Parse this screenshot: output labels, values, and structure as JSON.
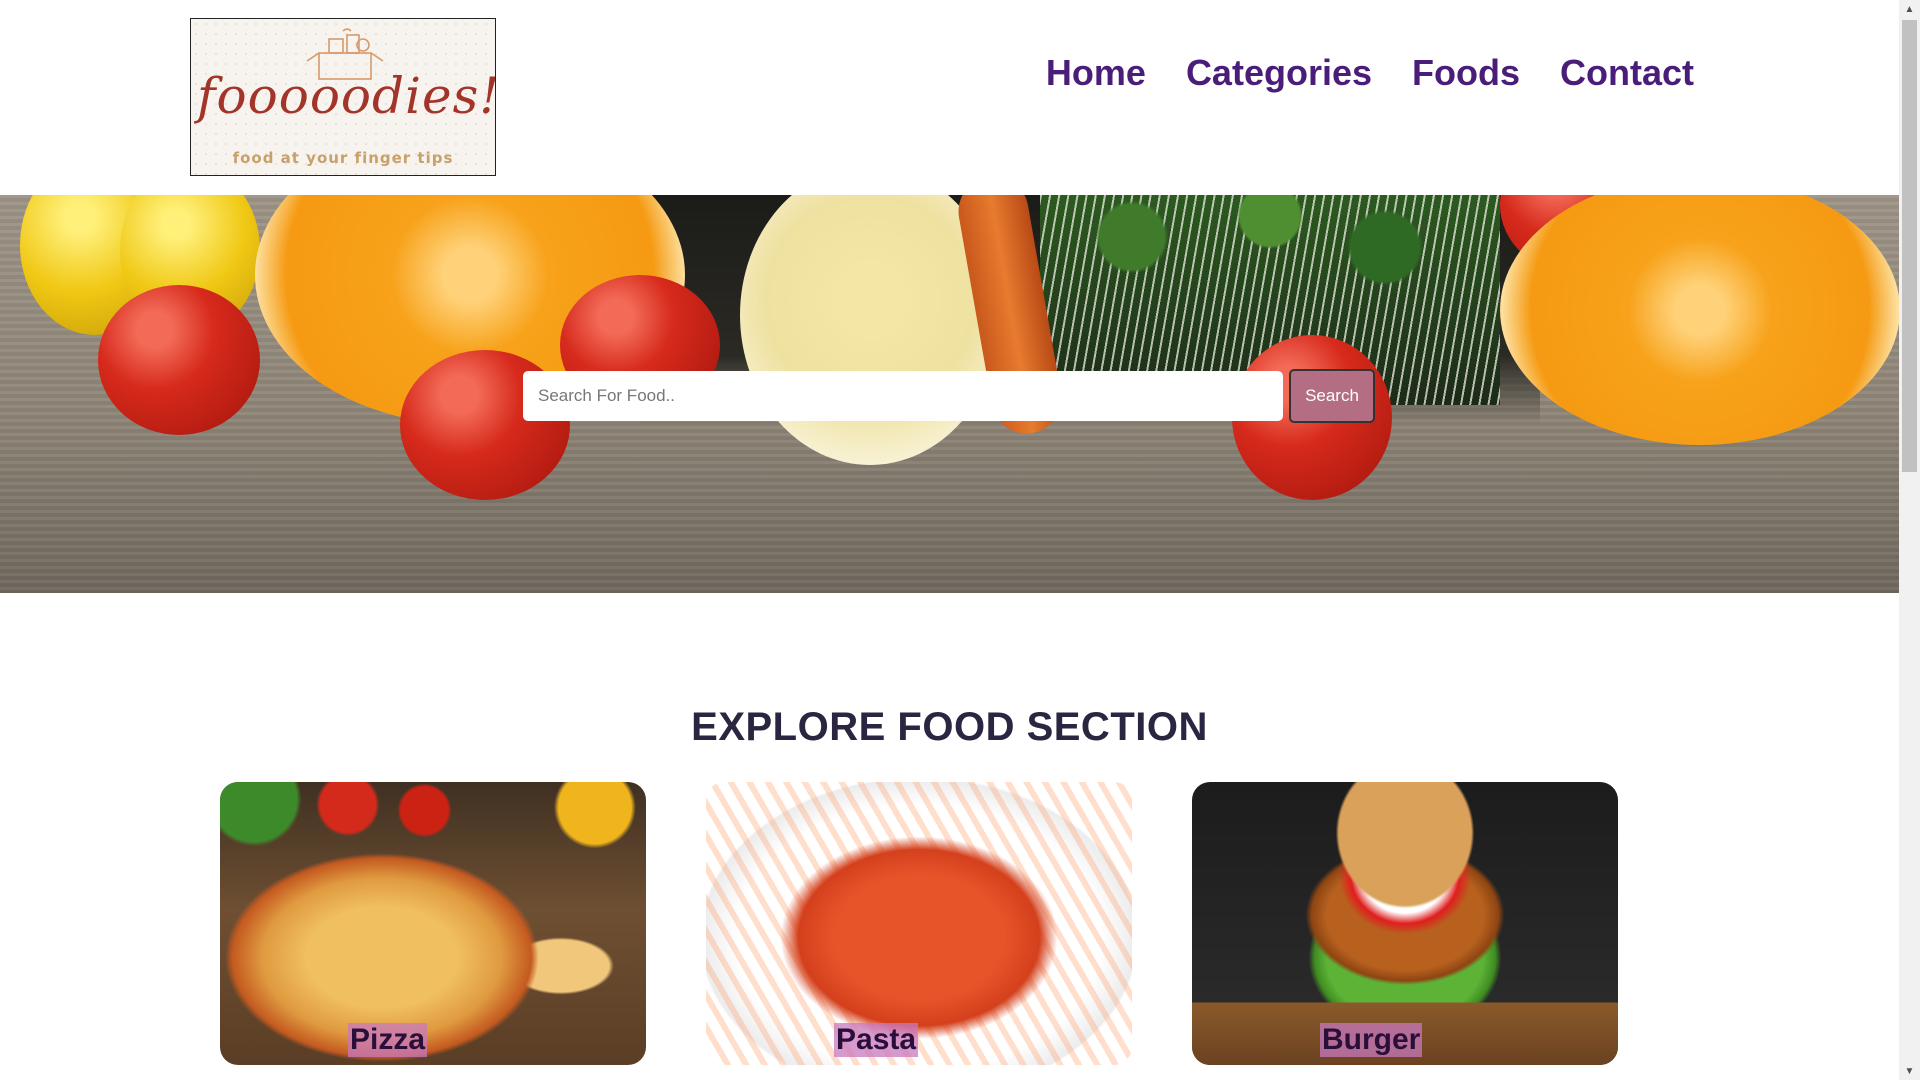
{
  "logo": {
    "text": "fooooodies!!!",
    "tagline": "food at your finger tips"
  },
  "nav": {
    "items": [
      {
        "label": "Home"
      },
      {
        "label": "Categories"
      },
      {
        "label": "Foods"
      },
      {
        "label": "Contact"
      }
    ]
  },
  "hero": {
    "search": {
      "placeholder": "Search For Food..",
      "button_label": "Search"
    }
  },
  "explore": {
    "title": "EXPLORE FOOD SECTION",
    "cards": [
      {
        "label": "Pizza"
      },
      {
        "label": "Pasta"
      },
      {
        "label": "Burger"
      }
    ]
  },
  "colors": {
    "nav_text": "#4b1d7a",
    "search_button": "#b46e83",
    "card_label_bg": "#c878be",
    "title_text": "#2a2540"
  }
}
